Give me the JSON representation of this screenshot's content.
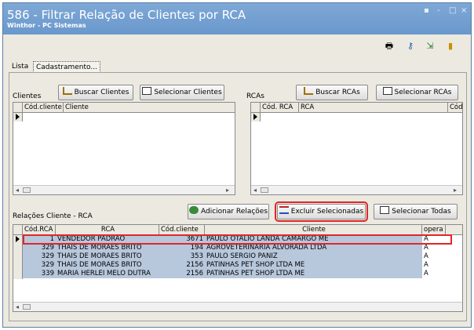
{
  "window": {
    "title": "586 - Filtrar Relação de Clientes por RCA",
    "subtitle": "Winthor - PC Sistemas",
    "controls": [
      "▪",
      "-",
      "□",
      "×"
    ]
  },
  "toolbar": {
    "icons": [
      "printer-icon",
      "key-icon",
      "arrow-down-icon",
      "door-exit-icon"
    ],
    "glyphs": [
      "🖶",
      "⚷",
      "⇲",
      "▮"
    ]
  },
  "tabs": [
    {
      "label": "Lista"
    },
    {
      "label": "Cadastramento..."
    }
  ],
  "clientes": {
    "section_label": "Clientes",
    "buscar_label": "Buscar Clientes",
    "selecionar_label": "Selecionar Clientes",
    "columns": [
      "Cód.cliente",
      "Cliente"
    ]
  },
  "rcas": {
    "section_label": "RCAs",
    "buscar_label": "Buscar RCAs",
    "selecionar_label": "Selecionar RCAs",
    "columns": [
      "Cód. RCA",
      "RCA",
      "Cód"
    ]
  },
  "relacoes": {
    "section_label": "Relações Cliente - RCA",
    "adicionar_label": "Adicionar Relações",
    "excluir_label": "Excluir Selecionadas",
    "selecionar_todas_label": "Selecionar Todas",
    "columns": [
      "Cód.RCA",
      "RCA",
      "Cód.cliente",
      "Cliente",
      "opera"
    ],
    "rows": [
      {
        "cod_rca": "1",
        "rca": "VENDEDOR PADRÃO",
        "cod_cliente": "3671",
        "cliente": "PAULO OTALIO LANDA CAMARGO ME",
        "opera": "A"
      },
      {
        "cod_rca": "329",
        "rca": "THAIS DE MORAES BRITO",
        "cod_cliente": "194",
        "cliente": "AGROVETERINARIA ALVORADA LTDA",
        "opera": "A"
      },
      {
        "cod_rca": "329",
        "rca": "THAIS DE MORAES BRITO",
        "cod_cliente": "353",
        "cliente": "PAULO SERGIO PANIZ",
        "opera": "A"
      },
      {
        "cod_rca": "329",
        "rca": "THAIS DE MORAES BRITO",
        "cod_cliente": "2156",
        "cliente": "PATINHAS PET SHOP LTDA ME",
        "opera": "A"
      },
      {
        "cod_rca": "339",
        "rca": "MARIA HERLEI MELO DUTRA",
        "cod_cliente": "2156",
        "cliente": "PATINHAS PET SHOP LTDA ME",
        "opera": "A"
      }
    ]
  },
  "colors": {
    "titlebar": "#6a98cc",
    "selection": "#b7c7dc",
    "highlight": "#e0262b"
  }
}
